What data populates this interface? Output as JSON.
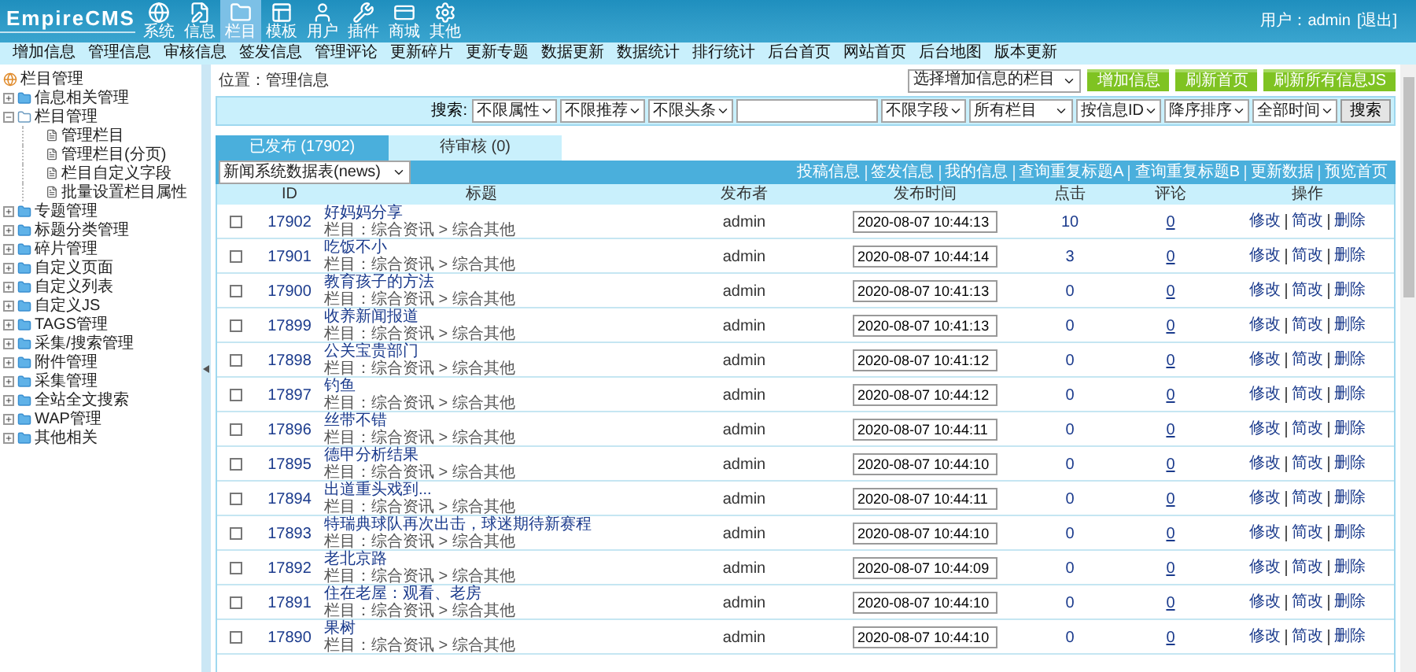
{
  "header": {
    "logo": "EmpireCMS",
    "nav": [
      {
        "label": "系统",
        "selected": false
      },
      {
        "label": "信息",
        "selected": false
      },
      {
        "label": "栏目",
        "selected": true
      },
      {
        "label": "模板",
        "selected": false
      },
      {
        "label": "用户",
        "selected": false
      },
      {
        "label": "插件",
        "selected": false
      },
      {
        "label": "商城",
        "selected": false
      },
      {
        "label": "其他",
        "selected": false
      }
    ],
    "user": "用户：admin",
    "logout": "[退出]"
  },
  "subnav": [
    "增加信息",
    "管理信息",
    "审核信息",
    "签发信息",
    "管理评论",
    "更新碎片",
    "更新专题",
    "数据更新",
    "数据统计",
    "排行统计",
    "后台首页",
    "网站首页",
    "后台地图",
    "版本更新"
  ],
  "sidebar": {
    "title": "栏目管理",
    "items": [
      {
        "label": "信息相关管理",
        "expanded": false
      },
      {
        "label": "栏目管理",
        "expanded": true,
        "children": [
          {
            "label": "管理栏目"
          },
          {
            "label": "管理栏目(分页)"
          },
          {
            "label": "栏目自定义字段"
          },
          {
            "label": "批量设置栏目属性"
          }
        ]
      },
      {
        "label": "专题管理",
        "expanded": false
      },
      {
        "label": "标题分类管理",
        "expanded": false
      },
      {
        "label": "碎片管理",
        "expanded": false
      },
      {
        "label": "自定义页面",
        "expanded": false
      },
      {
        "label": "自定义列表",
        "expanded": false
      },
      {
        "label": "自定义JS",
        "expanded": false
      },
      {
        "label": "TAGS管理",
        "expanded": false
      },
      {
        "label": "采集/搜索管理",
        "expanded": false
      },
      {
        "label": "附件管理",
        "expanded": false
      },
      {
        "label": "采集管理",
        "expanded": false
      },
      {
        "label": "全站全文搜索",
        "expanded": false
      },
      {
        "label": "WAP管理",
        "expanded": false
      },
      {
        "label": "其他相关",
        "expanded": false
      }
    ]
  },
  "breadcrumb": "位置：管理信息",
  "toolbar": {
    "column_select": "选择增加信息的栏目",
    "buttons": [
      "增加信息",
      "刷新首页",
      "刷新所有信息JS"
    ]
  },
  "search": {
    "label": "搜索:",
    "selects_left": [
      "不限属性",
      "不限推荐",
      "不限头条"
    ],
    "selects_right": [
      "不限字段",
      "所有栏目",
      "按信息ID",
      "降序排序",
      "全部时间"
    ],
    "button": "搜索"
  },
  "tabs": [
    {
      "label": "已发布 (17902)",
      "selected": true
    },
    {
      "label": "待审核 (0)",
      "selected": false
    }
  ],
  "table_select": "新闻系统数据表(news)",
  "links": [
    "投稿信息",
    "签发信息",
    "我的信息",
    "查询重复标题A",
    "查询重复标题B",
    "更新数据",
    "预览首页"
  ],
  "table": {
    "columns": [
      "ID",
      "标题",
      "发布者",
      "发布时间",
      "点击",
      "评论",
      "操作"
    ],
    "rows": [
      {
        "checked": false,
        "id": "17902",
        "title": "好妈妈分享",
        "column": "栏目：综合资讯 > 综合其他",
        "author": "admin",
        "time": "2020-08-07 10:44:13",
        "clicks": "10",
        "comments": "0",
        "actions": [
          "修改",
          "简改",
          "删除"
        ]
      },
      {
        "checked": false,
        "id": "17901",
        "title": "吃饭不小",
        "column": "栏目：综合资讯 > 综合其他",
        "author": "admin",
        "time": "2020-08-07 10:44:14",
        "clicks": "3",
        "comments": "0",
        "actions": [
          "修改",
          "简改",
          "删除"
        ]
      },
      {
        "checked": false,
        "id": "17900",
        "title": "教育孩子的方法",
        "column": "栏目：综合资讯 > 综合其他",
        "author": "admin",
        "time": "2020-08-07 10:41:13",
        "clicks": "0",
        "comments": "0",
        "actions": [
          "修改",
          "简改",
          "删除"
        ]
      },
      {
        "checked": false,
        "id": "17899",
        "title": "收养新闻报道",
        "column": "栏目：综合资讯 > 综合其他",
        "author": "admin",
        "time": "2020-08-07 10:41:13",
        "clicks": "0",
        "comments": "0",
        "actions": [
          "修改",
          "简改",
          "删除"
        ]
      },
      {
        "checked": false,
        "id": "17898",
        "title": "公关宝贵部门",
        "column": "栏目：综合资讯 > 综合其他",
        "author": "admin",
        "time": "2020-08-07 10:41:12",
        "clicks": "0",
        "comments": "0",
        "actions": [
          "修改",
          "简改",
          "删除"
        ]
      },
      {
        "checked": false,
        "id": "17897",
        "title": "钓鱼",
        "column": "栏目：综合资讯 > 综合其他",
        "author": "admin",
        "time": "2020-08-07 10:44:12",
        "clicks": "0",
        "comments": "0",
        "actions": [
          "修改",
          "简改",
          "删除"
        ]
      },
      {
        "checked": false,
        "id": "17896",
        "title": "丝带不错",
        "column": "栏目：综合资讯 > 综合其他",
        "author": "admin",
        "time": "2020-08-07 10:44:11",
        "clicks": "0",
        "comments": "0",
        "actions": [
          "修改",
          "简改",
          "删除"
        ]
      },
      {
        "checked": false,
        "id": "17895",
        "title": "德甲分析结果",
        "column": "栏目：综合资讯 > 综合其他",
        "author": "admin",
        "time": "2020-08-07 10:44:10",
        "clicks": "0",
        "comments": "0",
        "actions": [
          "修改",
          "简改",
          "删除"
        ]
      },
      {
        "checked": false,
        "id": "17894",
        "title": "出道重头戏到...",
        "column": "栏目：综合资讯 > 综合其他",
        "author": "admin",
        "time": "2020-08-07 10:44:11",
        "clicks": "0",
        "comments": "0",
        "actions": [
          "修改",
          "简改",
          "删除"
        ]
      },
      {
        "checked": false,
        "id": "17893",
        "title": "特瑞典球队再次出击，球迷期待新赛程",
        "column": "栏目：综合资讯 > 综合其他",
        "author": "admin",
        "time": "2020-08-07 10:44:10",
        "clicks": "0",
        "comments": "0",
        "actions": [
          "修改",
          "简改",
          "删除"
        ]
      },
      {
        "checked": false,
        "id": "17892",
        "title": "老北京路",
        "column": "栏目：综合资讯 > 综合其他",
        "author": "admin",
        "time": "2020-08-07 10:44:09",
        "clicks": "0",
        "comments": "0",
        "actions": [
          "修改",
          "简改",
          "删除"
        ]
      },
      {
        "checked": false,
        "id": "17891",
        "title": "住在老屋：观看、老房",
        "column": "栏目：综合资讯 > 综合其他",
        "author": "admin",
        "time": "2020-08-07 10:44:10",
        "clicks": "0",
        "comments": "0",
        "actions": [
          "修改",
          "简改",
          "删除"
        ]
      },
      {
        "checked": false,
        "id": "17890",
        "title": "果树",
        "column": "栏目：综合资讯 > 综合其他",
        "author": "admin",
        "time": "2020-08-07 10:44:10",
        "clicks": "0",
        "comments": "0",
        "actions": [
          "修改",
          "简改",
          "删除"
        ]
      }
    ]
  }
}
